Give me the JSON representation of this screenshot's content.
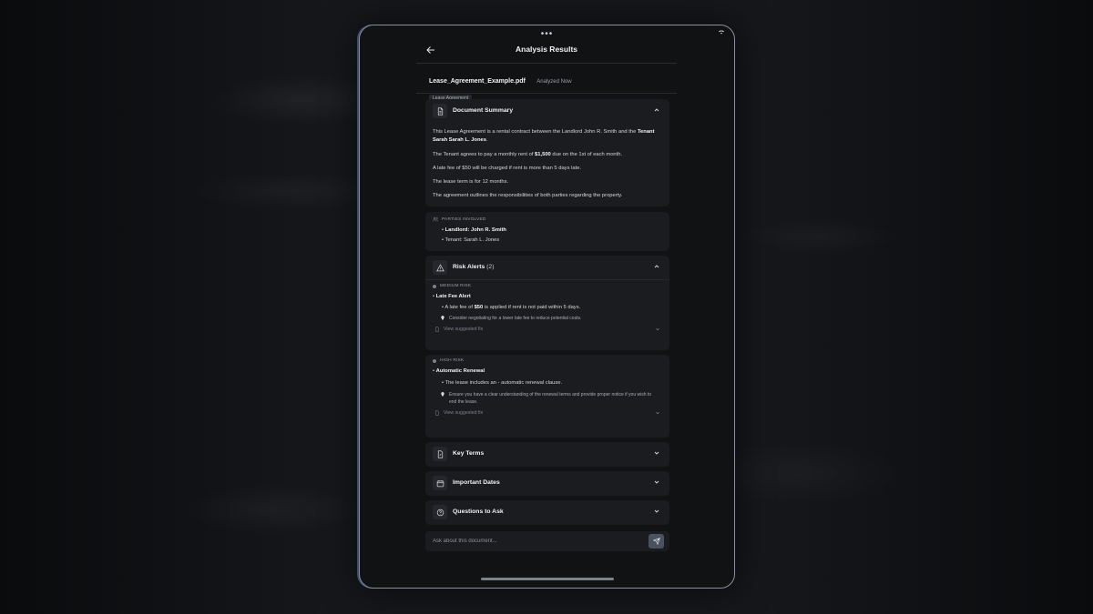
{
  "screen": {
    "title": "Analysis Results"
  },
  "file": {
    "name": "Lease_Agreement_Example.pdf",
    "status": "Analyzed Now",
    "tag": "Lease Agreement"
  },
  "summary": {
    "title": "Document Summary",
    "para1_a": "This Lease Agreement is a rental contract between the Landlord John R. Smith and the ",
    "para1_b": "Tenant Sarah Sarah L. Jones",
    "para1_c": ".",
    "para2_a": "The Tenant agrees to pay a monthly rent of ",
    "para2_b": "$1,500",
    "para2_c": " due on the 1st of each month.",
    "para3": "A late fee of $50 will be charged if rent is more than 5 days late.",
    "para4": "The lease term is for 12 months.",
    "para5": "The agreement outlines the responsibilities of both parties regarding the property."
  },
  "parties": {
    "label": "Parties Involved",
    "items": [
      "Landlord: John R. Smith",
      "Tenant: Sarah L. Jones"
    ]
  },
  "risks": {
    "title": "Risk Alerts",
    "count": "(2)",
    "alerts": [
      {
        "level": "Medium Risk",
        "name": "Late Fee Alert",
        "detail_a": "A late fee of ",
        "detail_b": "$50",
        "detail_c": " is applied if rent is not paid within 5 days.",
        "tip": "Consider negotiating for a lower late fee to reduce potential costs.",
        "fix": "View suggested fix"
      },
      {
        "level": "High Risk",
        "name": "Automatic Renewal",
        "detail": "The lease includes an - automatic renewal clause.",
        "tip": "Ensure you have a clear understanding of the renewal terms and provide proper notice if you wish to end the lease.",
        "fix": "View suggested fix"
      }
    ]
  },
  "sections": [
    {
      "title": "Key Terms"
    },
    {
      "title": "Important Dates"
    },
    {
      "title": "Questions to Ask"
    }
  ],
  "chat": {
    "placeholder": "Ask about this document..."
  },
  "status_bar": {
    "notch": "•••"
  },
  "colors": {
    "background": "#111214",
    "card": "#1b1c1f",
    "accent": "#4a5160",
    "text": "#e6e7ea"
  }
}
